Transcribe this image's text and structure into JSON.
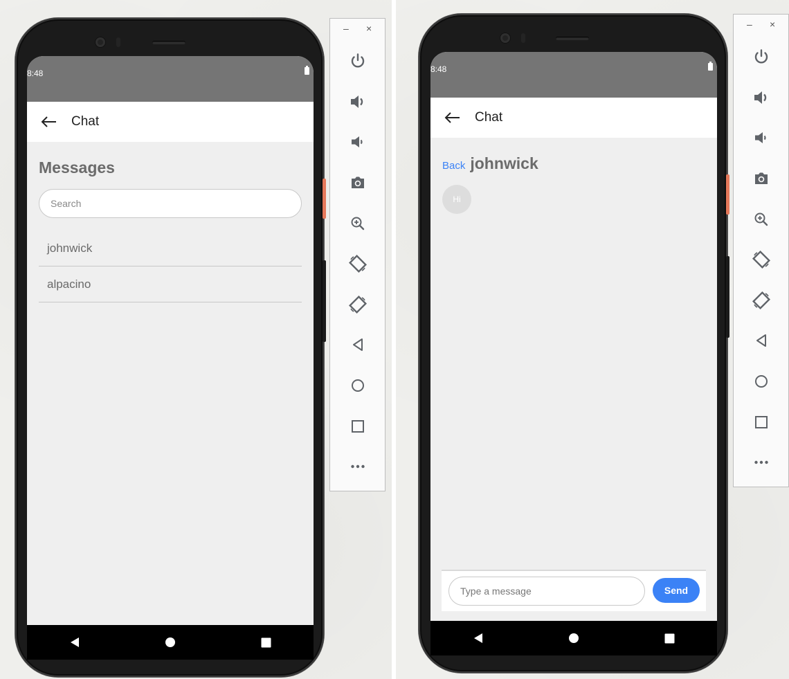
{
  "colors": {
    "status_bar": "#757575",
    "app_bar": "#ffffff",
    "screen_bg": "#efefef",
    "accent_blue": "#3b82f6",
    "toolbar_icon": "#5f6368"
  },
  "left_device": {
    "status_bar": {
      "time": "8:48",
      "battery_icon": "battery-icon"
    },
    "app_bar": {
      "back_icon": "arrow-left-icon",
      "title": "Chat"
    },
    "page": {
      "title": "Messages",
      "search_placeholder": "Search",
      "conversations": [
        {
          "name": "johnwick"
        },
        {
          "name": "alpacino"
        }
      ]
    },
    "nav_bar": [
      "back-triangle-icon",
      "home-circle-icon",
      "recents-square-icon"
    ]
  },
  "right_device": {
    "status_bar": {
      "time": "8:48",
      "battery_icon": "battery-icon"
    },
    "app_bar": {
      "back_icon": "arrow-left-icon",
      "title": "Chat"
    },
    "conversation": {
      "back_label": "Back",
      "contact_name": "johnwick",
      "messages": [
        {
          "text": "Hi"
        }
      ]
    },
    "composer": {
      "placeholder": "Type a message",
      "send_label": "Send"
    },
    "nav_bar": [
      "back-triangle-icon",
      "home-circle-icon",
      "recents-square-icon"
    ]
  },
  "emulator_toolbar": {
    "window_controls": {
      "minimize": "–",
      "close": "×"
    },
    "buttons": [
      "power-icon",
      "volume-up-icon",
      "volume-down-icon",
      "camera-icon",
      "zoom-in-icon",
      "rotate-left-icon",
      "rotate-right-icon",
      "back-icon",
      "home-icon",
      "overview-icon",
      "more-icon"
    ]
  }
}
